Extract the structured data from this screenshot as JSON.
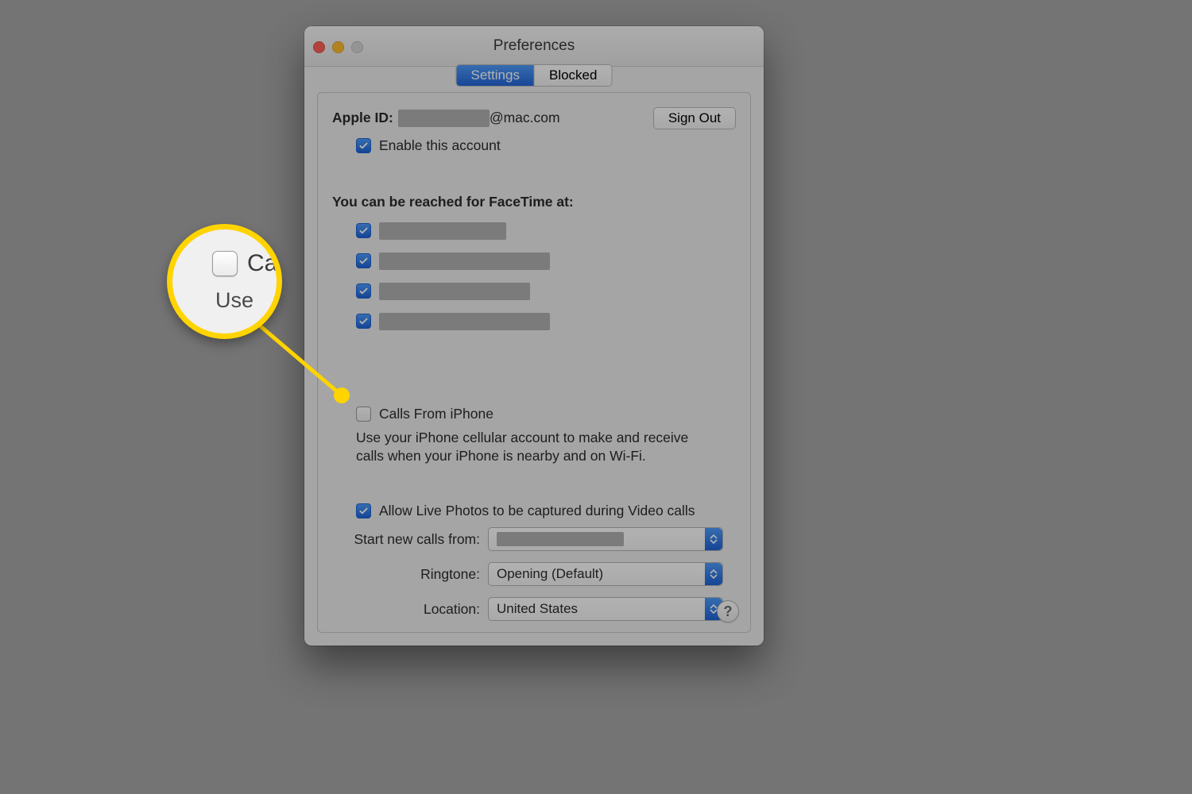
{
  "window": {
    "title": "Preferences"
  },
  "tabs": {
    "settings": "Settings",
    "blocked": "Blocked"
  },
  "appleId": {
    "label": "Apple ID:",
    "domain": "@mac.com",
    "signOut": "Sign Out",
    "enableLabel": "Enable this account"
  },
  "reach": {
    "title": "You can be reached for FaceTime at:"
  },
  "calls": {
    "label": "Calls From iPhone",
    "desc": "Use your iPhone cellular account to make and receive calls when your iPhone is nearby and on Wi-Fi."
  },
  "live": {
    "label": "Allow Live Photos to be captured during Video calls"
  },
  "selects": {
    "startLabel": "Start new calls from:",
    "startValue": "",
    "ringLabel": "Ringtone:",
    "ringValue": "Opening (Default)",
    "locLabel": "Location:",
    "locValue": "United States"
  },
  "help": "?",
  "callout": {
    "cal": "Cal",
    "use": "Use"
  }
}
